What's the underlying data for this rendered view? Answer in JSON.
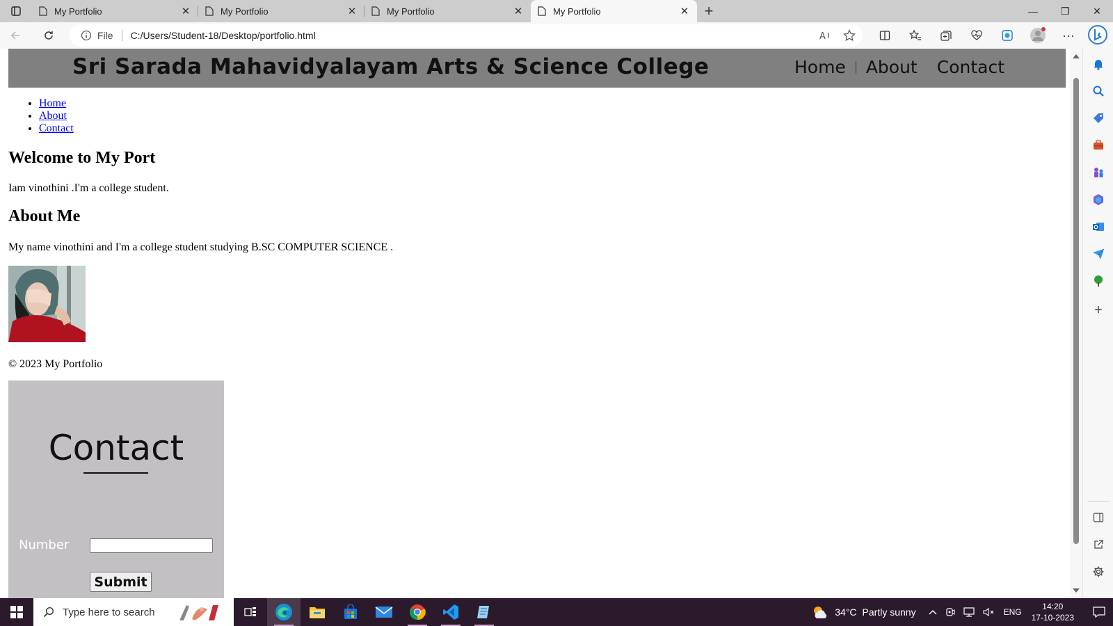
{
  "browser": {
    "tabs": [
      {
        "title": "My Portfolio",
        "active": false
      },
      {
        "title": "My Portfolio",
        "active": false
      },
      {
        "title": "My Portfolio",
        "active": false
      },
      {
        "title": "My Portfolio",
        "active": true
      }
    ],
    "address": {
      "scheme_label": "File",
      "url": "C:/Users/Student-18/Desktop/portfolio.html"
    }
  },
  "page": {
    "college_name": "Sri Sarada Mahavidyalayam Arts & Science College",
    "header_nav": [
      "Home",
      "About",
      "Contact"
    ],
    "list_nav": [
      "Home",
      "About",
      "Contact"
    ],
    "welcome_heading": "Welcome to My Port",
    "intro_text": "Iam vinothini .I'm a college student.",
    "about_heading": "About Me",
    "about_text": "My name vinothini and I'm a college student studying B.SC COMPUTER SCIENCE .",
    "copyright": "© 2023 My Portfolio",
    "contact": {
      "title": "Contact",
      "number_label": "Number",
      "number_value": "",
      "submit_label": "Submit"
    }
  },
  "taskbar": {
    "search_placeholder": "Type here to search",
    "weather": {
      "temp": "34°C",
      "condition": "Partly sunny"
    },
    "language": "ENG",
    "time": "14:20",
    "date": "17-10-2023"
  },
  "colors": {
    "header_bg": "#808080",
    "contact_bg": "#c3c0c3",
    "taskbar_bg": "#2b1a2b",
    "link": "#0000ee"
  }
}
